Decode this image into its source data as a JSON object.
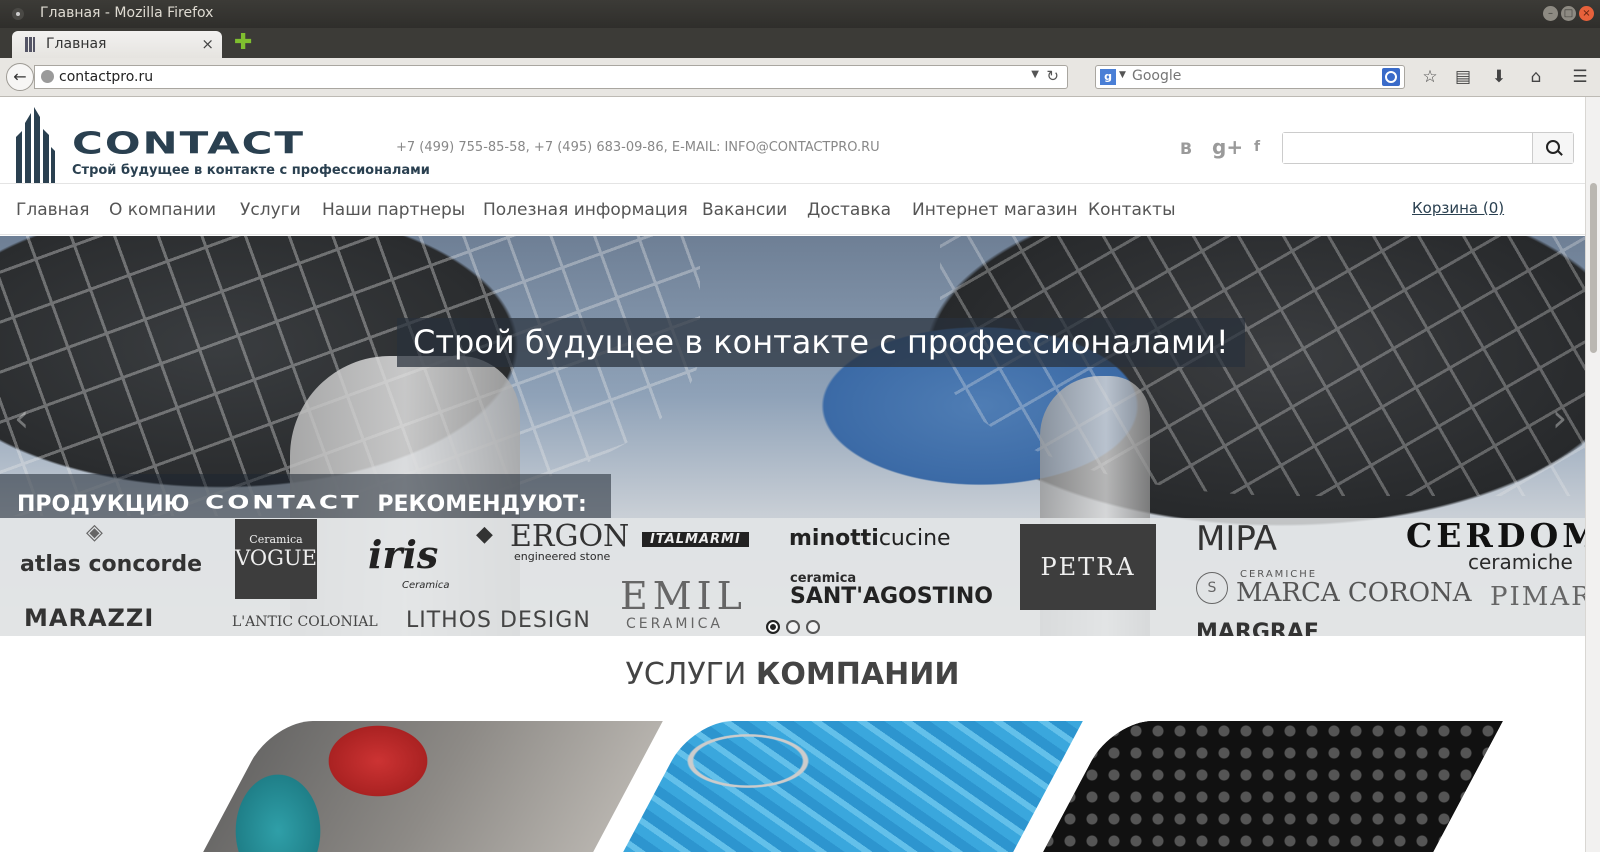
{
  "window": {
    "title": "Главная - Mozilla Firefox"
  },
  "tab": {
    "label": "Главная",
    "close": "×",
    "new_tab": "✚"
  },
  "browser": {
    "url": "contactpro.ru",
    "search_placeholder": "Google",
    "search_engine_icon": "g",
    "icons": [
      "back-icon",
      "reload-icon",
      "bookmark-star-icon",
      "reading-list-icon",
      "downloads-icon",
      "home-icon",
      "menu-icon"
    ]
  },
  "site": {
    "logo_word": "CONTACT",
    "logo_tagline": "Строй будущее в контакте с профессионалами",
    "contacts": "+7 (499) 755-85-58, +7 (495) 683-09-86, E-MAIL: INFO@CONTACTPRO.RU",
    "social": [
      "B",
      "g+",
      "f"
    ],
    "nav": [
      "Главная",
      "О компании",
      "Услуги",
      "Наши партнеры",
      "Полезная информация",
      "Вакансии",
      "Доставка",
      "Интернет магазин",
      "Контакты"
    ],
    "cart": "Корзина (0)",
    "hero_caption": "Строй будущее в контакте с профессионалами!",
    "recommend": {
      "prefix": "ПРОДУКЦИЮ",
      "brand": "CONTACT",
      "suffix": "РЕКОМЕНДУЮТ:"
    },
    "brands": {
      "atlas": "atlas concorde",
      "vogue_small": "Ceramica",
      "vogue": "VOGUE",
      "iris": "iris",
      "iris_sub": "Ceramica",
      "ergon": "ERGON",
      "ergon_sub": "engineered stone",
      "italmarmi": "ITALMARMI",
      "minotti_a": "minotti",
      "minotti_b": "cucine",
      "petra": "PETRA",
      "mipa": "MIPA",
      "cerdomus": "CERDOM",
      "cerdomus_sub": "ceramiche",
      "marazzi": "MARAZZI",
      "antic": "L'ANTIC COLONIAL",
      "lithos": "LITHOS DESIGN",
      "emil": "EMIL",
      "emil_sub": "CERAMICA",
      "santagostino_small": "ceramica",
      "santagostino": "SANT'AGOSTINO",
      "marca_small": "CERAMICHE",
      "marca": "MARCA CORONA",
      "pimar": "PIMAR",
      "margraf": "MARGRAF"
    },
    "services_title_light": "УСЛУГИ",
    "services_title_bold": "КОМПАНИИ",
    "slider_index": 1,
    "slider_count": 3
  }
}
